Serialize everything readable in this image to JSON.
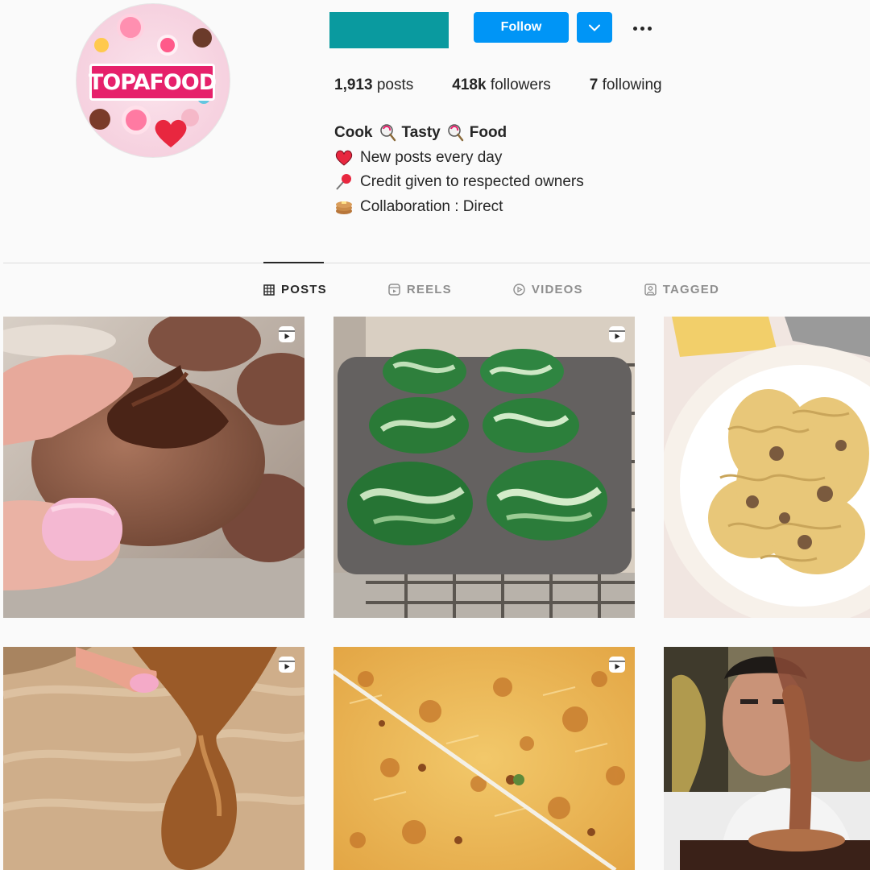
{
  "profile": {
    "avatar_text": "TOPAFOOD",
    "follow_label": "Follow",
    "stats": {
      "posts_count": "1,913",
      "posts_label": "posts",
      "followers_count": "418k",
      "followers_label": "followers",
      "following_count": "7",
      "following_label": "following"
    },
    "bio": {
      "name_parts": [
        "Cook",
        "Tasty",
        "Food"
      ],
      "lines": [
        {
          "icon": "heart-emoji",
          "text": "New posts every day"
        },
        {
          "icon": "pushpin-emoji",
          "text": "Credit given to respected owners"
        },
        {
          "icon": "pancakes-emoji",
          "text": "Collaboration : Direct"
        }
      ]
    }
  },
  "tabs": [
    {
      "label": "POSTS",
      "icon": "grid-icon",
      "active": true
    },
    {
      "label": "REELS",
      "icon": "reels-icon",
      "active": false
    },
    {
      "label": "VIDEOS",
      "icon": "play-icon",
      "active": false
    },
    {
      "label": "TAGGED",
      "icon": "tag-icon",
      "active": false
    }
  ],
  "posts": [
    {
      "subject": "chocolate-hazelnut-cookie",
      "reel": true
    },
    {
      "subject": "green-swirl-cupcakes",
      "reel": true
    },
    {
      "subject": "fusilli-pasta",
      "reel": false
    },
    {
      "subject": "caramel-drizzle",
      "reel": true
    },
    {
      "subject": "crispy-potato-rosti",
      "reel": true
    },
    {
      "subject": "chocolate-pour",
      "reel": false
    }
  ],
  "colors": {
    "accent": "#0095f6",
    "username_block": "#0a9a9f",
    "logo_pink": "#e6216b",
    "text": "#262626",
    "muted": "#8e8e8e"
  }
}
